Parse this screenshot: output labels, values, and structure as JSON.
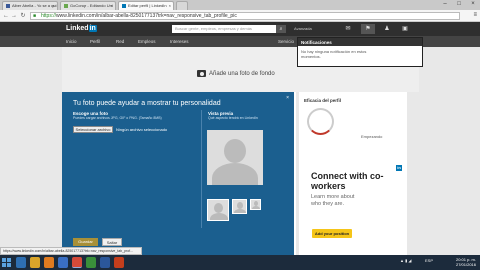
{
  "browser": {
    "tabs": [
      {
        "label": "Alber Abella - Yo se a qui"
      },
      {
        "label": "GoConqr - Editando Uni"
      },
      {
        "label": "Editar perfil | LinkedIn"
      }
    ],
    "url_scheme": "https://",
    "url_rest": "www.linkedin.com/in/albar-abella-8250177137trk=nav_responsive_tab_profile_pic",
    "status_text": "https://www.linkedin.com/in/albar-abella-825017713?trk=nav_responsive_tab_prof..."
  },
  "linkedin": {
    "logo": "in",
    "search_placeholder": "Buscar gente, empleos, empresas y demás",
    "advanced": "Avanzada",
    "nav": [
      "Inicio",
      "Perfil",
      "Red",
      "Empleos",
      "Intereses",
      "Servicio"
    ],
    "add_cover": "Añade una foto de fondo"
  },
  "notifications": {
    "header": "Notificaciones",
    "body": "No hay ninguna notificación en estos momentos."
  },
  "modal": {
    "title": "Tu foto puede ayudar a mostrar tu personalidad",
    "close": "×",
    "choose_label": "Escoge una foto",
    "choose_sub": "Puedes cargar archivos JPG, GIF o PNG. (Tamaño 8MB)",
    "choose_button": "Seleccionar archivo",
    "no_file": "Ningún archivo seleccionado",
    "preview_label": "Vista previa",
    "preview_sub": "Qué aspecto tendrá en LinkedIn",
    "save": "Guardar",
    "skip": "Saltar"
  },
  "strength": {
    "label": "Eficacia del perfil",
    "level": "Empezando"
  },
  "ad": {
    "logo": "in",
    "headline": "Connect with co-workers",
    "body": "Learn more about who they are.",
    "cta": "Add your position"
  },
  "taskbar": {
    "lang": "ESP",
    "time": "20:01 p. m.",
    "date": "27/01/2016"
  },
  "colors": {
    "linkedin_blue": "#0077b5",
    "modal_blue": "#1b5f8f",
    "cta_yellow": "#f5c518"
  }
}
